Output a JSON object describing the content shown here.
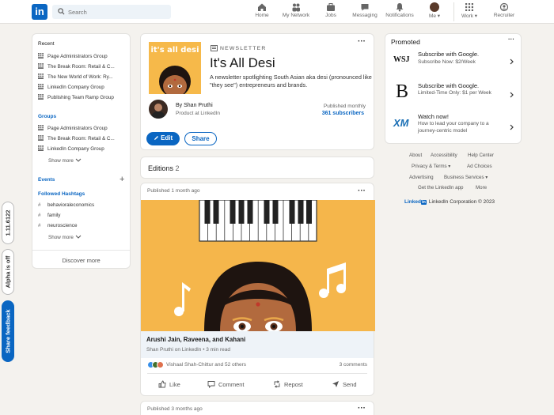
{
  "topbar": {
    "logo": "in",
    "search_placeholder": "Search",
    "nav": [
      {
        "label": "Home",
        "icon": "home-icon"
      },
      {
        "label": "My Network",
        "icon": "network-icon"
      },
      {
        "label": "Jobs",
        "icon": "briefcase-icon"
      },
      {
        "label": "Messaging",
        "icon": "messaging-icon"
      },
      {
        "label": "Notifications",
        "icon": "bell-icon"
      },
      {
        "label": "Me ▾",
        "icon": "avatar"
      },
      {
        "label": "Work ▾",
        "icon": "grid-icon"
      },
      {
        "label": "Recruiter",
        "icon": "recruiter-icon"
      }
    ]
  },
  "left": {
    "recent_label": "Recent",
    "recent": [
      "Page Administrators Group",
      "The Break Room: Retail & C...",
      "The New World of Work: Ry...",
      "LinkedIn Company Group",
      "Publishing Team Ramp Group"
    ],
    "groups_label": "Groups",
    "groups": [
      "Page Administrators Group",
      "The Break Room: Retail & C...",
      "LinkedIn Company Group"
    ],
    "show_more": "Show more",
    "events_label": "Events",
    "events_plus": "+",
    "hashtags_label": "Followed Hashtags",
    "hashtags": [
      "behavioraleconomics",
      "family",
      "neuroscience"
    ],
    "show_more_2": "Show more",
    "discover": "Discover more"
  },
  "newsletter": {
    "cover_text": "it's all desi",
    "kind": "NEWSLETTER",
    "title": "It's All Desi",
    "description": "A newsletter spotlighting South Asian aka desi (pronounced like \"they see\") entrepreneurs and brands.",
    "author": "By Shan Pruthi",
    "author_role": "Product at LinkedIn",
    "frequency": "Published monthly",
    "subscribers": "361 subscribers",
    "edit_label": "Edit",
    "share_label": "Share"
  },
  "editions": {
    "label": "Editions",
    "count": "2"
  },
  "post": {
    "published": "Published 1 month ago",
    "title": "Arushi Jain, Raveena, and Kahani",
    "meta": "Shan Pruthi on LinkedIn • 3 min read",
    "reactions": "Vishaal Shah-Chittur and 52 others",
    "comments": "3 comments",
    "actions": [
      "Like",
      "Comment",
      "Repost",
      "Send"
    ]
  },
  "post2": {
    "published": "Published 3 months ago"
  },
  "promoted": {
    "label": "Promoted",
    "ads": [
      {
        "logo": "WSJ",
        "title": "Subscribe with Google.",
        "sub": "Subscribe Now: $2/Week"
      },
      {
        "logo": "B",
        "title": "Subscribe with Google.",
        "sub": "Limited-Time Only: $1 per Week"
      },
      {
        "logo": "XM",
        "title": "Watch now!",
        "sub": "How to lead your company to a journey-centric model"
      }
    ]
  },
  "footer": {
    "row1": [
      "About",
      "Accessibility",
      "Help Center"
    ],
    "row2": [
      "Privacy & Terms ▾",
      "Ad Choices"
    ],
    "row3": [
      "Advertising",
      "Business Services ▾"
    ],
    "row4": [
      "Get the LinkedIn app",
      "More"
    ],
    "brand": "Linked",
    "brand_in": "in",
    "copyright": "LinkedIn Corporation © 2023"
  },
  "side_tabs": [
    "1.11.6122",
    "Alpha is off",
    "Share feedback"
  ]
}
